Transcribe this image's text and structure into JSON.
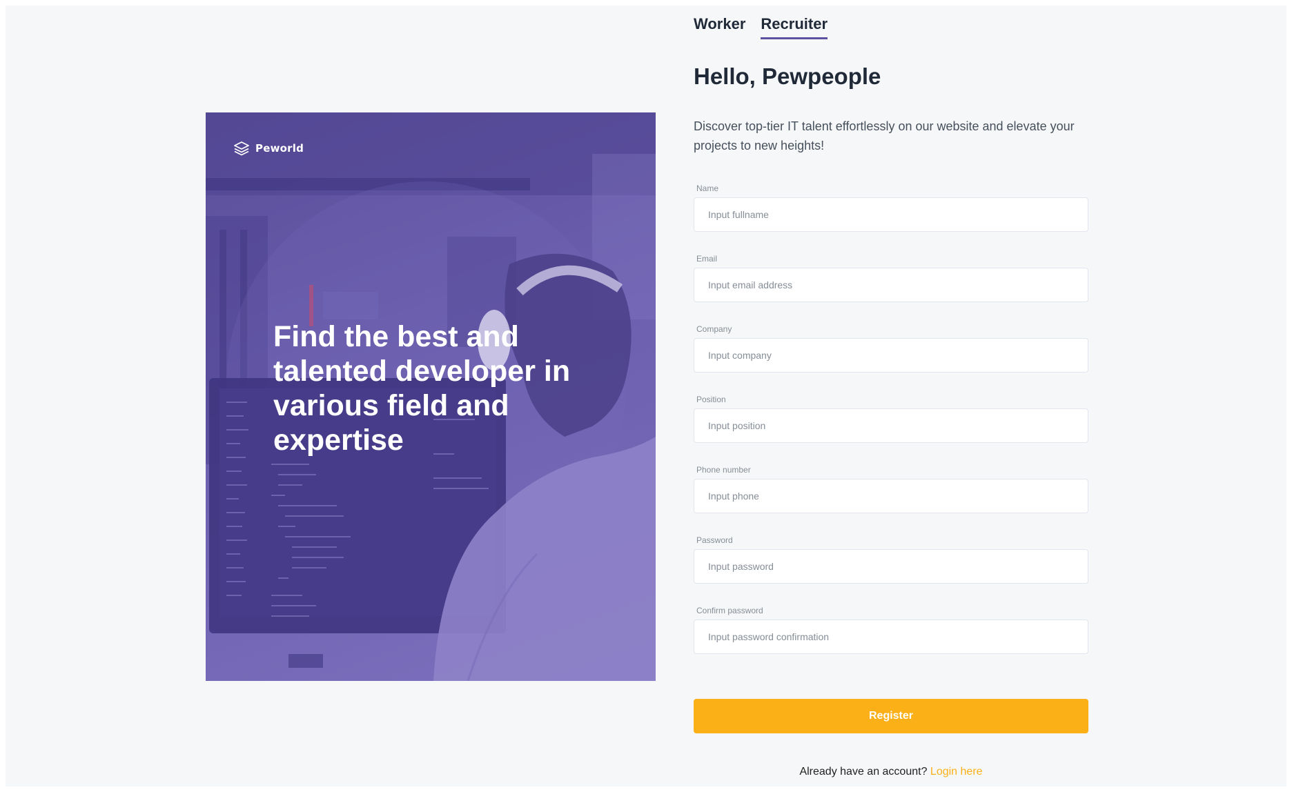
{
  "hero": {
    "brand_name": "Peworld",
    "brand_icon": "stacked-layers-icon",
    "headline": "Find the best and talented developer in various field and expertise"
  },
  "tabs": [
    {
      "label": "Worker",
      "active": false
    },
    {
      "label": "Recruiter",
      "active": true
    }
  ],
  "greeting": "Hello, Pewpeople",
  "intro": "Discover top-tier IT talent effortlessly on our website and elevate your projects to new heights!",
  "form": {
    "fields": [
      {
        "label": "Name",
        "placeholder": "Input fullname",
        "value": ""
      },
      {
        "label": "Email",
        "placeholder": "Input email address",
        "value": ""
      },
      {
        "label": "Company",
        "placeholder": "Input company",
        "value": ""
      },
      {
        "label": "Position",
        "placeholder": "Input position",
        "value": ""
      },
      {
        "label": "Phone number",
        "placeholder": "Input phone",
        "value": ""
      },
      {
        "label": "Password",
        "placeholder": "Input password",
        "value": ""
      },
      {
        "label": "Confirm password",
        "placeholder": "Input password confirmation",
        "value": ""
      }
    ],
    "submit_label": "Register"
  },
  "footer": {
    "prompt": "Already have an account?",
    "link_label": "Login here"
  },
  "colors": {
    "brand_purple": "#5e50a1",
    "accent_yellow": "#fbb017",
    "page_background": "#f6f7f8",
    "text_dark": "#1f2937"
  }
}
